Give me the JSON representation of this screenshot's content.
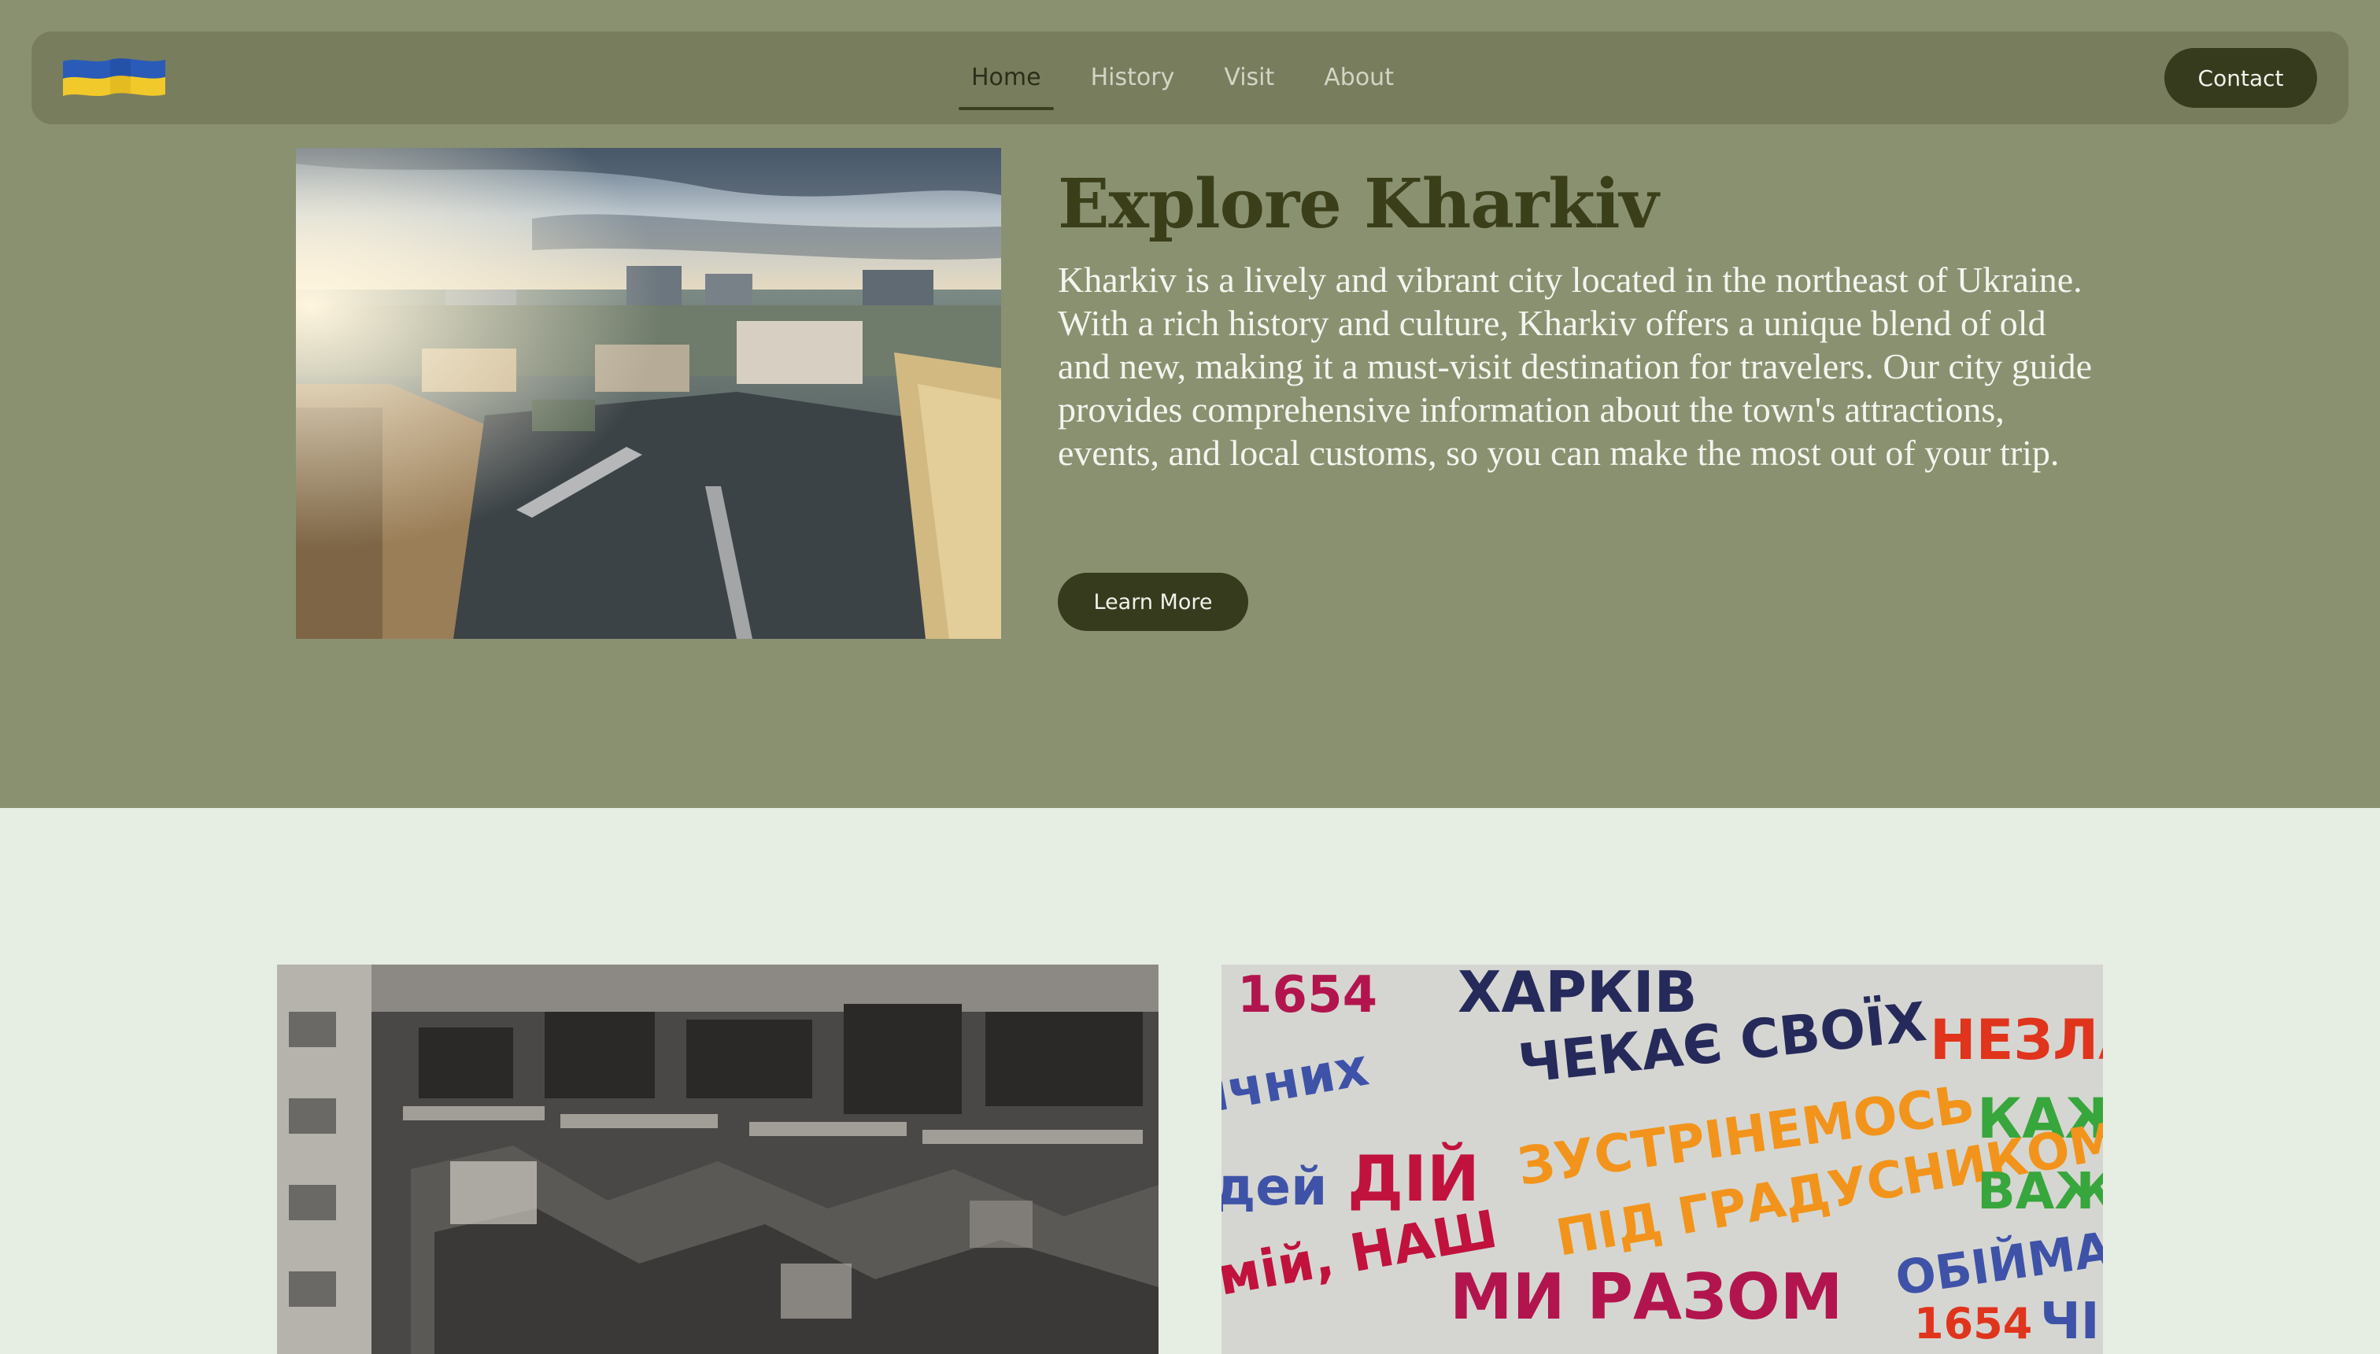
{
  "nav": {
    "logo_icon": "ukraine-flag-icon",
    "flag_colors": [
      "#2a5bb8",
      "#f1c92b"
    ],
    "links": [
      {
        "label": "Home",
        "active": true
      },
      {
        "label": "History",
        "active": false
      },
      {
        "label": "Visit",
        "active": false
      },
      {
        "label": "About",
        "active": false
      }
    ],
    "contact_label": "Contact"
  },
  "hero": {
    "title": "Explore Kharkiv",
    "body": "Kharkiv is a lively and vibrant city located in the northeast of Ukraine. With a rich history and culture, Kharkiv offers a unique blend of old and new, making it a must-visit destination for travelers. Our city guide provides comprehensive information about the town's attractions, events, and local customs, so you can make the most out of your trip.",
    "button_label": "Learn More"
  },
  "graffiti": {
    "lines": [
      "1654",
      "ХАРКІВ",
      "ЧЕКАЄ СВОЇХ",
      "НЕЗЛА",
      "ічних",
      "дей",
      "ДІЙ",
      "ЗУСТРІНЕМОСЬ",
      "КАЖ",
      "ПІД ГРАДУСНИКОМ",
      "ВАЖ.",
      "мій, НАШ",
      "МИ РАЗОМ",
      "ОБІЙМА",
      "1654",
      "ЧІ"
    ]
  },
  "colors": {
    "hero_bg": "#8a9170",
    "navbar_bg": "#787d5e",
    "button_bg": "#363b1e",
    "page_bg": "#e6ede3",
    "title_color": "#3a3f19"
  }
}
